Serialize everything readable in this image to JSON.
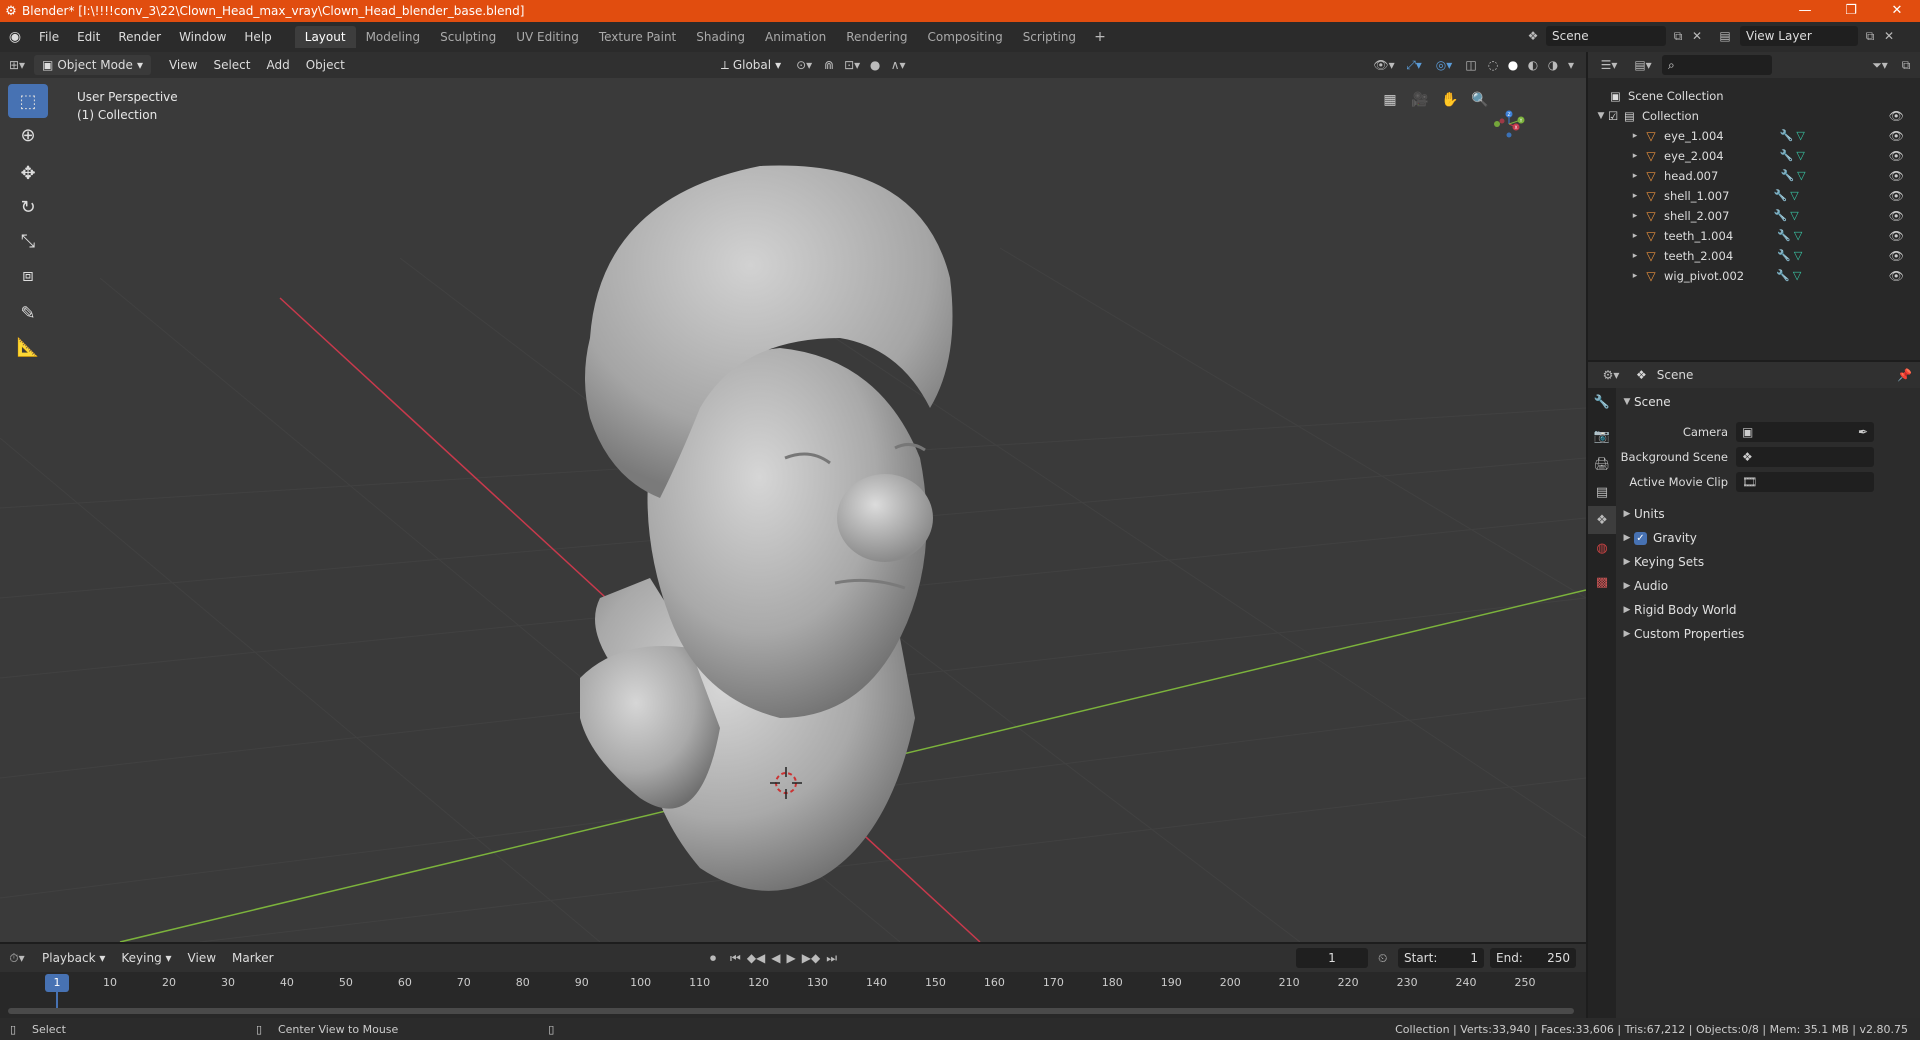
{
  "titlebar": {
    "title": "Blender* [I:\\!!!!conv_3\\22\\Clown_Head_max_vray\\Clown_Head_blender_base.blend]",
    "minimize": "—",
    "maximize": "❐",
    "close": "✕"
  },
  "menubar": {
    "items": [
      "File",
      "Edit",
      "Render",
      "Window",
      "Help"
    ],
    "workspaces": [
      "Layout",
      "Modeling",
      "Sculpting",
      "UV Editing",
      "Texture Paint",
      "Shading",
      "Animation",
      "Rendering",
      "Compositing",
      "Scripting"
    ],
    "active_workspace": "Layout",
    "add": "+",
    "scene": "Scene",
    "view_layer": "View Layer"
  },
  "viewport_header": {
    "mode": "Object Mode",
    "menus": [
      "View",
      "Select",
      "Add",
      "Object"
    ],
    "transform_orientation": "Global"
  },
  "viewport": {
    "perspective": "User Perspective",
    "collection": "(1) Collection",
    "gizmo": {
      "z": "Z",
      "x": "X",
      "y": "Y"
    }
  },
  "outliner": {
    "search_placeholder": "",
    "scene_collection": "Scene Collection",
    "collection": "Collection",
    "objects": [
      "eye_1.004",
      "eye_2.004",
      "head.007",
      "shell_1.007",
      "shell_2.007",
      "teeth_1.004",
      "teeth_2.004",
      "wig_pivot.002"
    ]
  },
  "properties": {
    "header": "Scene",
    "panel": "Scene",
    "camera_label": "Camera",
    "background_scene_label": "Background Scene",
    "active_movie_clip_label": "Active Movie Clip",
    "sections": [
      "Units",
      "Gravity",
      "Keying Sets",
      "Audio",
      "Rigid Body World",
      "Custom Properties"
    ],
    "gravity_checked": true
  },
  "timeline": {
    "menus": [
      "Playback",
      "Keying",
      "View",
      "Marker"
    ],
    "current_frame": "1",
    "start_label": "Start:",
    "start": "1",
    "end_label": "End:",
    "end": "250",
    "ticks": [
      "1",
      "10",
      "20",
      "30",
      "40",
      "50",
      "60",
      "70",
      "80",
      "90",
      "100",
      "110",
      "120",
      "130",
      "140",
      "150",
      "160",
      "170",
      "180",
      "190",
      "200",
      "210",
      "220",
      "230",
      "240",
      "250"
    ]
  },
  "statusbar": {
    "select": "Select",
    "center_view": "Center View to Mouse",
    "stats": "Collection | Verts:33,940 | Faces:33,606 | Tris:67,212 | Objects:0/8 | Mem: 35.1 MB | v2.80.75"
  },
  "colors": {
    "titlebar": "#e14d0f",
    "accent": "#4772b3",
    "x_axis": "#c8394c",
    "y_axis": "#7cb33c",
    "z_axis": "#3c7fd6"
  }
}
